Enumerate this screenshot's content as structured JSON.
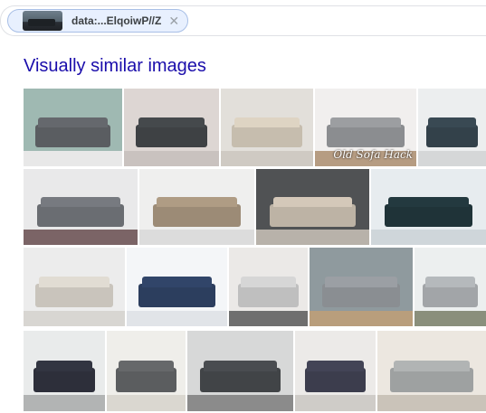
{
  "search": {
    "chip_label": "data:...ElqoiwP//Z",
    "chip_thumb": "sofa-thumbnail",
    "close_icon": "close-icon"
  },
  "section": {
    "title": "Visually similar images"
  },
  "images": [
    {
      "wall": "#9fb9b2",
      "floor": "#e8e8e8",
      "sofa": "#5a5d61",
      "caption": ""
    },
    {
      "wall": "#ddd6d3",
      "floor": "#c9c2bf",
      "sofa": "#3e4144",
      "caption": ""
    },
    {
      "wall": "#e2dfda",
      "floor": "#cfcac3",
      "sofa": "#c6bdae",
      "caption": ""
    },
    {
      "wall": "#f1efee",
      "floor": "#b69c82",
      "sofa": "#8b8d90",
      "caption": "Old Sofa Hack"
    },
    {
      "wall": "#eceeef",
      "floor": "#d5d7d8",
      "sofa": "#33414a",
      "caption": ""
    },
    {
      "wall": "#e9e9ea",
      "floor": "#7b6466",
      "sofa": "#6a6d72",
      "caption": ""
    },
    {
      "wall": "#efefee",
      "floor": "#dcdcdc",
      "sofa": "#9c8b76",
      "caption": ""
    },
    {
      "wall": "#505254",
      "floor": "#b8b2aa",
      "sofa": "#bdb3a5",
      "caption": ""
    },
    {
      "wall": "#e7ecef",
      "floor": "#cfd6da",
      "sofa": "#1f3338",
      "caption": ""
    },
    {
      "wall": "#ececec",
      "floor": "#d8d6d2",
      "sofa": "#c9c4bc",
      "caption": ""
    },
    {
      "wall": "#f4f6f8",
      "floor": "#e1e4e8",
      "sofa": "#2c3e5e",
      "caption": ""
    },
    {
      "wall": "#ebe9e7",
      "floor": "#6f6f6f",
      "sofa": "#bfbfbf",
      "caption": ""
    },
    {
      "wall": "#8f9a9e",
      "floor": "#b99e7c",
      "sofa": "#8a8e92",
      "caption": ""
    },
    {
      "wall": "#ecefef",
      "floor": "#8a8f7c",
      "sofa": "#a2a5a8",
      "caption": ""
    },
    {
      "wall": "#e9ebeb",
      "floor": "#b2b4b4",
      "sofa": "#2d2f3a",
      "caption": ""
    },
    {
      "wall": "#efeeea",
      "floor": "#dad7d0",
      "sofa": "#5b5d5f",
      "caption": ""
    },
    {
      "wall": "#d7d8d8",
      "floor": "#8b8b8b",
      "sofa": "#414447",
      "caption": ""
    },
    {
      "wall": "#eceae8",
      "floor": "#cfccc8",
      "sofa": "#3c3d4d",
      "caption": ""
    },
    {
      "wall": "#ece7e0",
      "floor": "#cac3b9",
      "sofa": "#9ea1a1",
      "caption": ""
    }
  ]
}
